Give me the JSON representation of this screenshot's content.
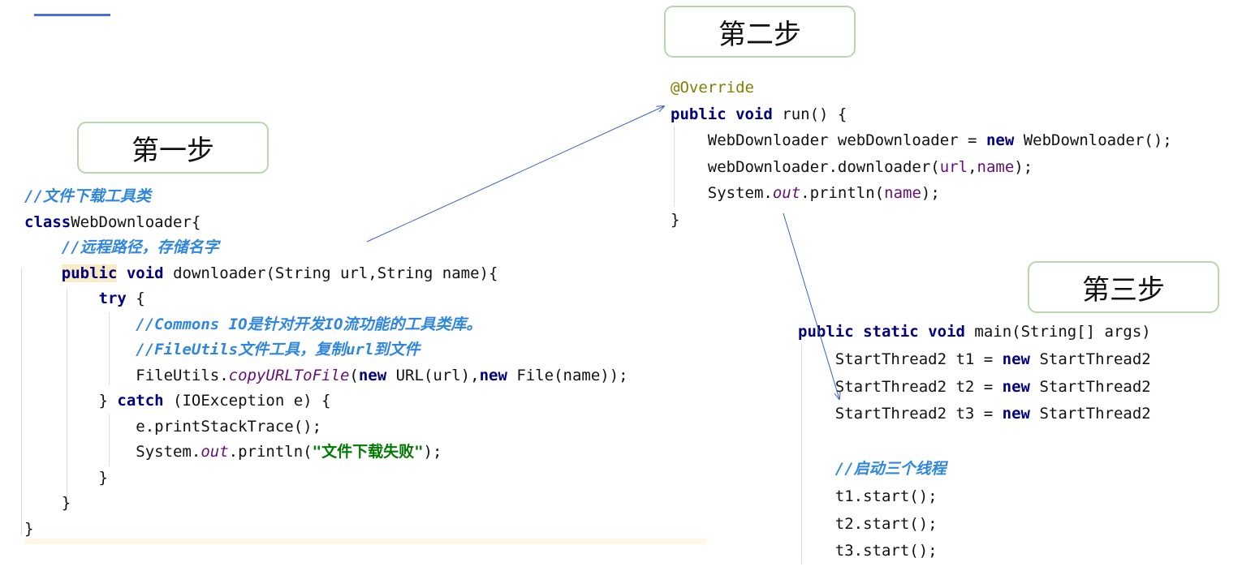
{
  "steps": {
    "one": "第一步",
    "two": "第二步",
    "three": "第三步"
  },
  "block1": [
    [
      [
        "cm",
        "//文件下载工具类"
      ]
    ],
    [
      [
        "kw",
        "class"
      ],
      [
        "",
        "WebDownloader{"
      ]
    ],
    [
      [
        "",
        "    "
      ],
      [
        "cm",
        "//远程路径，存储名字"
      ]
    ],
    [
      [
        "",
        "    "
      ],
      [
        "kw hl",
        "public"
      ],
      [
        "",
        " "
      ],
      [
        "kw",
        "void"
      ],
      [
        "",
        " downloader(String url,String name){"
      ]
    ],
    [
      [
        "",
        "        "
      ],
      [
        "kw",
        "try"
      ],
      [
        "",
        " {"
      ]
    ],
    [
      [
        "",
        "            "
      ],
      [
        "cm",
        "//Commons IO是针对开发IO流功能的工具类库。"
      ]
    ],
    [
      [
        "",
        "            "
      ],
      [
        "cm",
        "//FileUtils文件工具，复制url到文件"
      ]
    ],
    [
      [
        "",
        "            FileUtils."
      ],
      [
        "fld",
        "copyURLToFile"
      ],
      [
        "",
        "("
      ],
      [
        "kw",
        "new"
      ],
      [
        "",
        " URL(url),"
      ],
      [
        "kw",
        "new"
      ],
      [
        "",
        " File(name));"
      ]
    ],
    [
      [
        "",
        "        } "
      ],
      [
        "kw",
        "catch"
      ],
      [
        "",
        " (IOException e) {"
      ]
    ],
    [
      [
        "",
        "            e.printStackTrace();"
      ]
    ],
    [
      [
        "",
        "            System."
      ],
      [
        "fld",
        "out"
      ],
      [
        "",
        ".println("
      ],
      [
        "str",
        "\"文件下载失败\""
      ],
      [
        "",
        ");"
      ]
    ],
    [
      [
        "",
        "        }"
      ]
    ],
    [
      [
        "",
        "    }"
      ]
    ],
    [
      [
        "",
        "}"
      ]
    ]
  ],
  "block2": [
    [
      [
        "ann",
        "@Override"
      ]
    ],
    [
      [
        "kw",
        "public"
      ],
      [
        "",
        " "
      ],
      [
        "kw",
        "void"
      ],
      [
        "",
        " run() {"
      ]
    ],
    [
      [
        "",
        "    WebDownloader webDownloader = "
      ],
      [
        "kw",
        "new"
      ],
      [
        "",
        " WebDownloader();"
      ]
    ],
    [
      [
        "",
        "    webDownloader.downloader("
      ],
      [
        "var",
        "url"
      ],
      [
        "",
        ","
      ],
      [
        "var",
        "name"
      ],
      [
        "",
        ");"
      ]
    ],
    [
      [
        "",
        "    System."
      ],
      [
        "fld",
        "out"
      ],
      [
        "",
        ".println("
      ],
      [
        "var",
        "name"
      ],
      [
        "",
        ");"
      ]
    ],
    [
      [
        "",
        "}"
      ]
    ]
  ],
  "block3": [
    [
      [
        "kw",
        "public"
      ],
      [
        "",
        " "
      ],
      [
        "kw",
        "static"
      ],
      [
        "",
        " "
      ],
      [
        "kw",
        "void"
      ],
      [
        "",
        " main(String[] args)"
      ]
    ],
    [
      [
        "",
        "    StartThread2 t1 = "
      ],
      [
        "kw",
        "new"
      ],
      [
        "",
        " StartThread2"
      ]
    ],
    [
      [
        "",
        "    StartThread2 t2 = "
      ],
      [
        "kw",
        "new"
      ],
      [
        "",
        " StartThread2"
      ]
    ],
    [
      [
        "",
        "    StartThread2 t3 = "
      ],
      [
        "kw",
        "new"
      ],
      [
        "",
        " StartThread2"
      ]
    ],
    [
      [
        "",
        ""
      ]
    ],
    [
      [
        "",
        "    "
      ],
      [
        "cm",
        "//启动三个线程"
      ]
    ],
    [
      [
        "",
        "    t1.start();"
      ]
    ],
    [
      [
        "",
        "    t2.start();"
      ]
    ],
    [
      [
        "",
        "    t3.start();"
      ]
    ]
  ]
}
